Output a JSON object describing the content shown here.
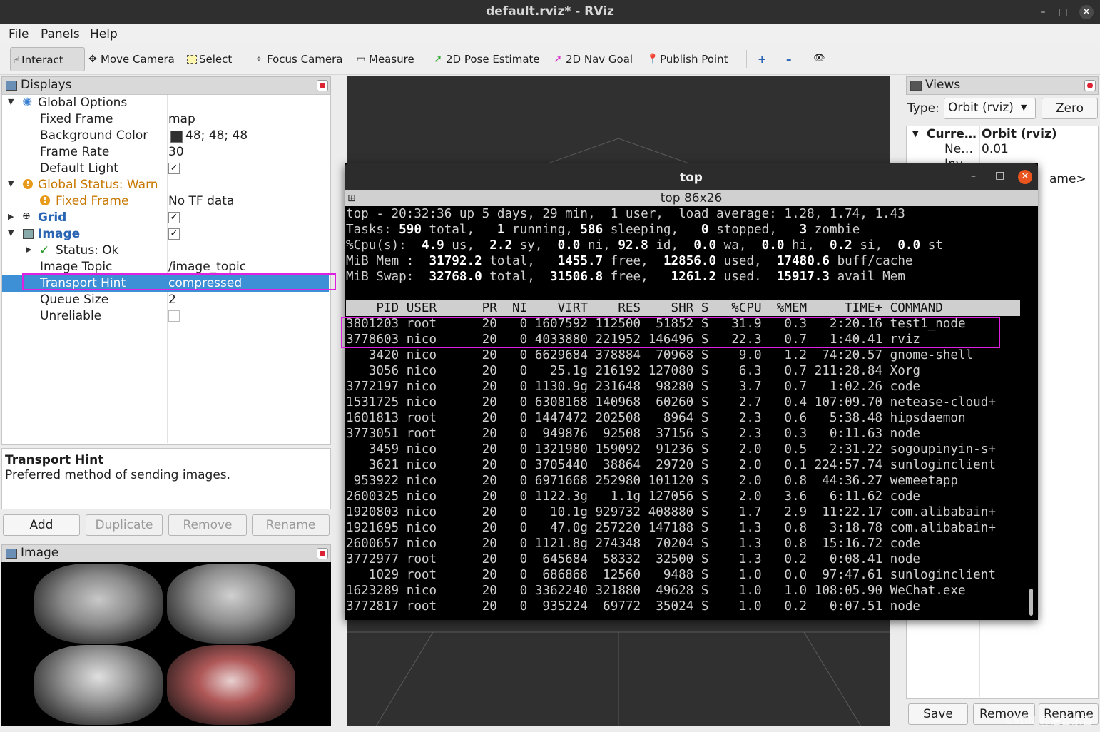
{
  "window": {
    "title": "default.rviz* - RViz",
    "controls": [
      "–",
      "□",
      "✕"
    ]
  },
  "menubar": [
    "File",
    "Panels",
    "Help"
  ],
  "toolbar": {
    "tools": [
      "Interact",
      "Move Camera",
      "Select",
      "Focus Camera",
      "Measure",
      "2D Pose Estimate",
      "2D Nav Goal",
      "Publish Point"
    ],
    "extra": [
      "+",
      "–",
      "👁"
    ]
  },
  "displays": {
    "title": "Displays",
    "rows": [
      {
        "key": "Global Options",
        "value": ""
      },
      {
        "key": "Fixed Frame",
        "value": "map"
      },
      {
        "key": "Background Color",
        "value": "48; 48; 48"
      },
      {
        "key": "Frame Rate",
        "value": "30"
      },
      {
        "key": "Default Light",
        "value": "✓"
      },
      {
        "key": "Global Status: Warn",
        "value": ""
      },
      {
        "key": "Fixed Frame",
        "value": "No TF data"
      },
      {
        "key": "Grid",
        "value": "✓"
      },
      {
        "key": "Image",
        "value": "✓"
      },
      {
        "key": "Status: Ok",
        "value": ""
      },
      {
        "key": "Image Topic",
        "value": "/image_topic"
      },
      {
        "key": "Transport Hint",
        "value": "compressed"
      },
      {
        "key": "Queue Size",
        "value": "2"
      },
      {
        "key": "Unreliable",
        "value": ""
      }
    ],
    "description": {
      "title": "Transport Hint",
      "text": "Preferred method of sending images."
    },
    "buttons": [
      "Add",
      "Duplicate",
      "Remove",
      "Rename"
    ]
  },
  "image_panel": {
    "title": "Image"
  },
  "views": {
    "title": "Views",
    "type_label": "Type:",
    "type_value": "Orbit (rviz)",
    "zero": "Zero",
    "tree": [
      {
        "key": "Curre…",
        "value": "Orbit (rviz)"
      },
      {
        "key": "Ne…",
        "value": "0.01"
      },
      {
        "key": "Inv…",
        "value": ""
      }
    ],
    "overflow_text": "ame>",
    "buttons": [
      "Save",
      "Remove",
      "Rename"
    ]
  },
  "terminal": {
    "title": "top",
    "tab": "top 86x26",
    "summary": [
      "top - 20:32:36 up 5 days, 29 min,  1 user,  load average: 1.28, 1.74, 1.43",
      "Tasks: 590 total,   1 running, 586 sleeping,   0 stopped,   3 zombie",
      "%Cpu(s):  4.9 us,  2.2 sy,  0.0 ni, 92.8 id,  0.0 wa,  0.0 hi,  0.2 si,  0.0 st",
      "MiB Mem :  31792.2 total,   1455.7 free,  12856.0 used,  17480.6 buff/cache",
      "MiB Swap:  32768.0 total,  31506.8 free,   1261.2 used.  15917.3 avail Mem"
    ],
    "columns": [
      "PID",
      "USER",
      "PR",
      "NI",
      "VIRT",
      "RES",
      "SHR",
      "S",
      "%CPU",
      "%MEM",
      "TIME+",
      "COMMAND"
    ],
    "processes": [
      [
        "3801203",
        "root",
        "20",
        "0",
        "1607592",
        "112500",
        "51852",
        "S",
        "31.9",
        "0.3",
        "2:20.16",
        "test1_node"
      ],
      [
        "3778603",
        "nico",
        "20",
        "0",
        "4033880",
        "221952",
        "146496",
        "S",
        "22.3",
        "0.7",
        "1:40.41",
        "rviz"
      ],
      [
        "3420",
        "nico",
        "20",
        "0",
        "6629684",
        "378884",
        "70968",
        "S",
        "9.0",
        "1.2",
        "74:20.57",
        "gnome-shell"
      ],
      [
        "3056",
        "nico",
        "20",
        "0",
        "25.1g",
        "216192",
        "127080",
        "S",
        "6.3",
        "0.7",
        "211:28.84",
        "Xorg"
      ],
      [
        "3772197",
        "nico",
        "20",
        "0",
        "1130.9g",
        "231648",
        "98280",
        "S",
        "3.7",
        "0.7",
        "1:02.26",
        "code"
      ],
      [
        "1531725",
        "nico",
        "20",
        "0",
        "6308168",
        "140968",
        "60260",
        "S",
        "2.7",
        "0.4",
        "107:09.70",
        "netease-cloud+"
      ],
      [
        "1601813",
        "root",
        "20",
        "0",
        "1447472",
        "202508",
        "8964",
        "S",
        "2.3",
        "0.6",
        "5:38.48",
        "hipsdaemon"
      ],
      [
        "3773051",
        "root",
        "20",
        "0",
        "949876",
        "92508",
        "37156",
        "S",
        "2.3",
        "0.3",
        "0:11.63",
        "node"
      ],
      [
        "3459",
        "nico",
        "20",
        "0",
        "1321980",
        "159092",
        "91236",
        "S",
        "2.0",
        "0.5",
        "2:31.22",
        "sogoupinyin-s+"
      ],
      [
        "3621",
        "nico",
        "20",
        "0",
        "3705440",
        "38864",
        "29720",
        "S",
        "2.0",
        "0.1",
        "224:57.74",
        "sunloginclient"
      ],
      [
        "953922",
        "nico",
        "20",
        "0",
        "6971668",
        "252980",
        "101120",
        "S",
        "2.0",
        "0.8",
        "44:36.27",
        "wemeetapp"
      ],
      [
        "2600325",
        "nico",
        "20",
        "0",
        "1122.3g",
        "1.1g",
        "127056",
        "S",
        "2.0",
        "3.6",
        "6:11.62",
        "code"
      ],
      [
        "1920803",
        "nico",
        "20",
        "0",
        "10.1g",
        "929732",
        "408880",
        "S",
        "1.7",
        "2.9",
        "11:22.17",
        "com.alibabain+"
      ],
      [
        "1921695",
        "nico",
        "20",
        "0",
        "47.0g",
        "257220",
        "147188",
        "S",
        "1.3",
        "0.8",
        "3:18.78",
        "com.alibabain+"
      ],
      [
        "2600657",
        "nico",
        "20",
        "0",
        "1121.8g",
        "274348",
        "70204",
        "S",
        "1.3",
        "0.8",
        "15:16.72",
        "code"
      ],
      [
        "3772977",
        "root",
        "20",
        "0",
        "645684",
        "58332",
        "32500",
        "S",
        "1.3",
        "0.2",
        "0:08.41",
        "node"
      ],
      [
        "1029",
        "root",
        "20",
        "0",
        "686868",
        "12560",
        "9488",
        "S",
        "1.0",
        "0.0",
        "97:47.61",
        "sunloginclient"
      ],
      [
        "1623289",
        "nico",
        "20",
        "0",
        "3362240",
        "321880",
        "49628",
        "S",
        "1.0",
        "1.0",
        "108:05.90",
        "WeChat.exe"
      ],
      [
        "3772817",
        "root",
        "20",
        "0",
        "935224",
        "69772",
        "35024",
        "S",
        "1.0",
        "0.2",
        "0:07.51",
        "node"
      ]
    ]
  },
  "watermark": "CSDN @语音余音",
  "colors": {
    "highlight": "#e020e0",
    "selection": "#3d8fd6",
    "warn": "#c87800",
    "link": "#2a65b3"
  }
}
